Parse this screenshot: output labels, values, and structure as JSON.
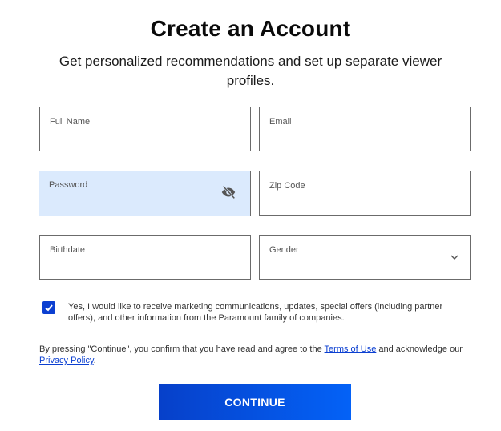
{
  "header": {
    "title": "Create an Account",
    "subtitle": "Get personalized recommendations and set up separate viewer profiles."
  },
  "form": {
    "full_name": {
      "label": "Full Name",
      "value": ""
    },
    "email": {
      "label": "Email",
      "value": ""
    },
    "password": {
      "label": "Password",
      "value": "",
      "icon": "eye-slash-icon"
    },
    "zip_code": {
      "label": "Zip Code",
      "value": ""
    },
    "birthdate": {
      "label": "Birthdate",
      "value": ""
    },
    "gender": {
      "label": "Gender",
      "value": "",
      "icon": "chevron-down-icon"
    }
  },
  "consent": {
    "checked": true,
    "text": "Yes, I would like to receive marketing communications, updates, special offers (including partner offers), and other information from the Paramount family of companies."
  },
  "legal": {
    "prefix": "By pressing \"Continue\", you confirm that you have read and agree to the ",
    "terms_link": "Terms of Use",
    "middle": " and acknowledge our ",
    "privacy_link": "Privacy Policy",
    "suffix": "."
  },
  "buttons": {
    "continue_label": "CONTINUE"
  },
  "colors": {
    "accent": "#0b3fd1",
    "active_field_bg": "#dbeafd"
  }
}
